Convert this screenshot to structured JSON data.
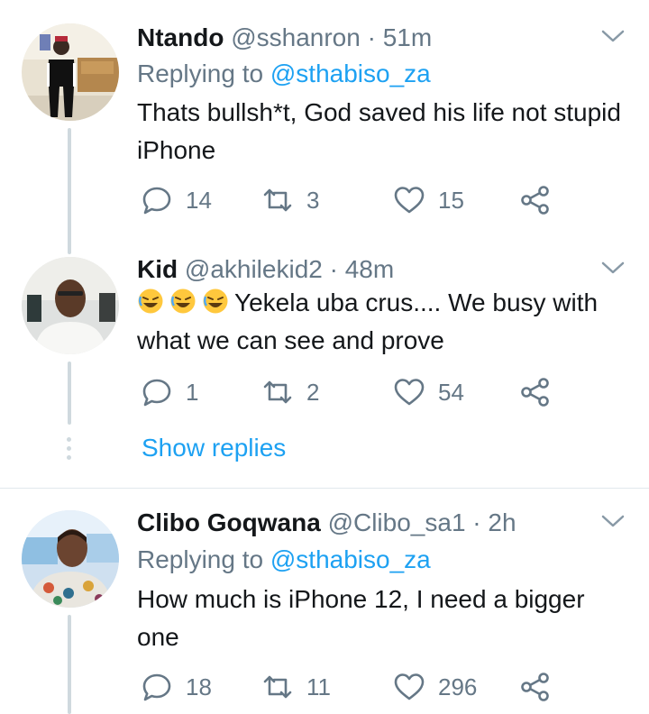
{
  "tweets": [
    {
      "name": "Ntando",
      "handle": "@sshanron",
      "time": "51m",
      "reply_prefix": "Replying to",
      "reply_mention": "@sthabiso_za",
      "text": "Thats bullsh*t, God saved his life not stupid iPhone",
      "replies": "14",
      "retweets": "3",
      "likes": "15"
    },
    {
      "name": "Kid",
      "handle": "@akhilekid2",
      "time": "48m",
      "emojis": [
        "rolling-on-floor-laughing",
        "rolling-on-floor-laughing",
        "rolling-on-floor-laughing"
      ],
      "text": "Yekela uba crus.... We busy with what we can see and prove",
      "replies": "1",
      "retweets": "2",
      "likes": "54",
      "show_replies": "Show replies"
    },
    {
      "name": "Clibo Goqwana",
      "handle": "@Clibo_sa1",
      "time": "2h",
      "reply_prefix": "Replying to",
      "reply_mention": "@sthabiso_za",
      "text": "How much is iPhone 12, I need a bigger one",
      "replies": "18",
      "retweets": "11",
      "likes": "296"
    }
  ],
  "separator": "·",
  "colors": {
    "text": "#14171a",
    "secondary": "#657786",
    "accent": "#1da1f2",
    "thread_line": "#cfd9de"
  }
}
